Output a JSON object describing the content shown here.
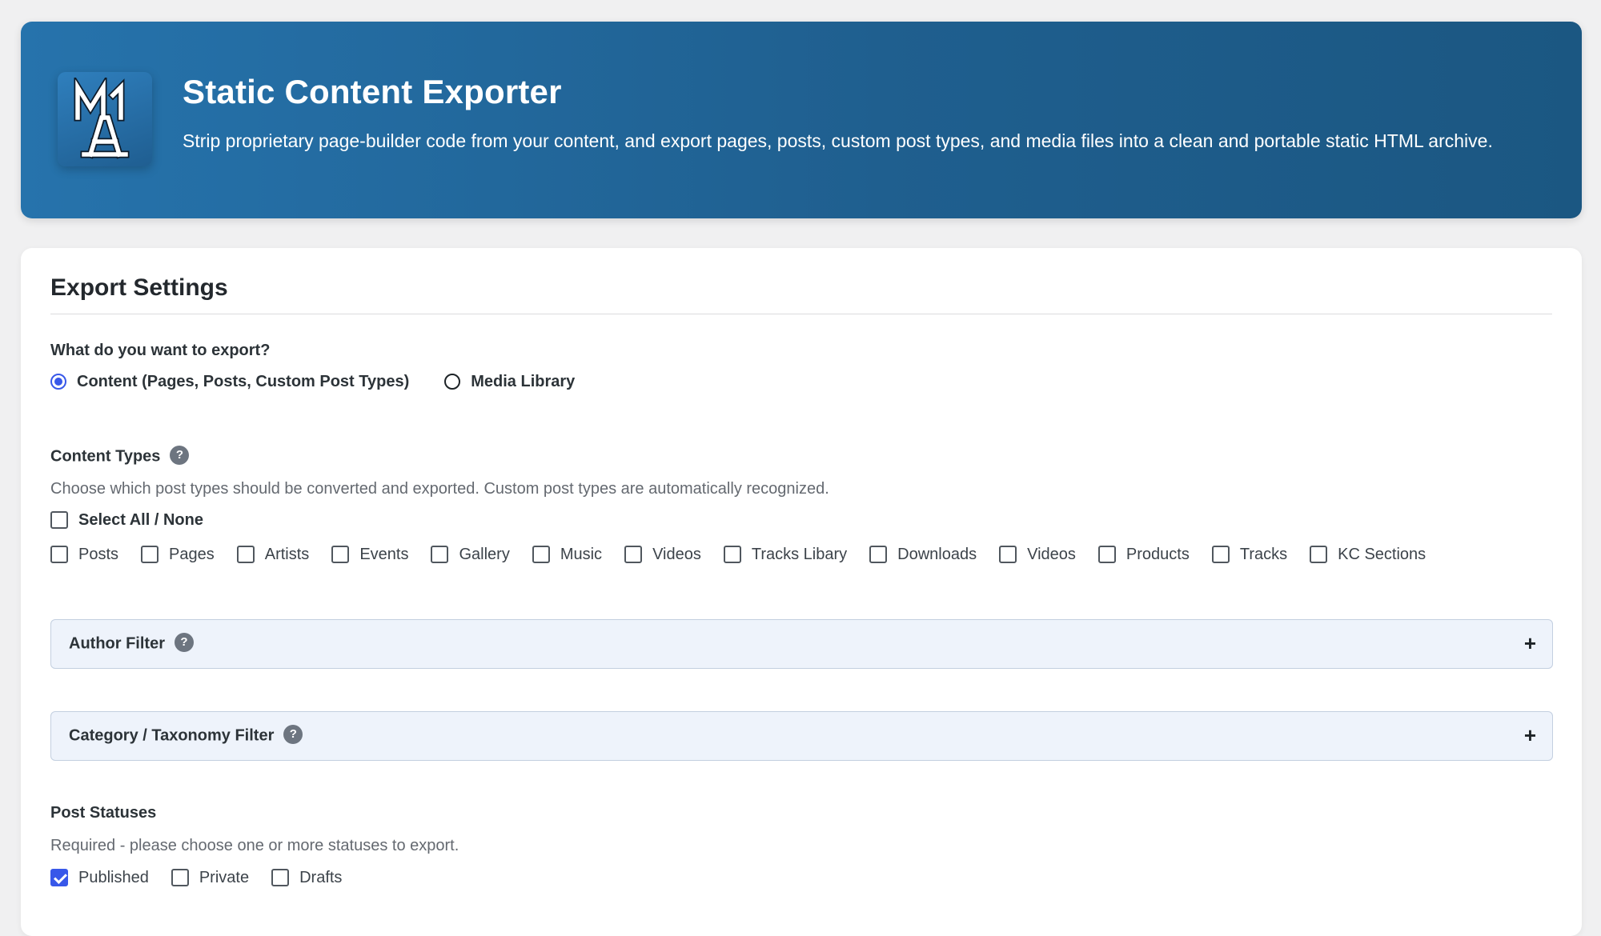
{
  "header": {
    "title": "Static Content Exporter",
    "description": "Strip proprietary page-builder code from your content, and export pages, posts, custom post types, and media files into a clean and portable static HTML archive.",
    "logo_icon": "tower-monogram-logo",
    "gradient_start": "#2673ac",
    "gradient_end": "#1b5782"
  },
  "export_settings": {
    "title": "Export Settings",
    "export_question": "What do you want to export?",
    "export_options": [
      {
        "label": "Content (Pages, Posts, Custom Post Types)",
        "checked": true
      },
      {
        "label": "Media Library",
        "checked": false
      }
    ],
    "content_types": {
      "label": "Content Types",
      "help_glyph": "?",
      "description": "Choose which post types should be converted and exported. Custom post types are automatically recognized.",
      "select_all_label": "Select All / None",
      "items": [
        "Posts",
        "Pages",
        "Artists",
        "Events",
        "Gallery",
        "Music",
        "Videos",
        "Tracks Libary",
        "Downloads",
        "Videos",
        "Products",
        "Tracks",
        "KC Sections"
      ]
    },
    "author_filter": {
      "label": "Author Filter",
      "help_glyph": "?",
      "toggle": "+"
    },
    "taxonomy_filter": {
      "label": "Category / Taxonomy Filter",
      "help_glyph": "?",
      "toggle": "+"
    },
    "post_statuses": {
      "label": "Post Statuses",
      "description": "Required - please choose one or more statuses to export.",
      "items": [
        {
          "label": "Published",
          "checked": true
        },
        {
          "label": "Private",
          "checked": false
        },
        {
          "label": "Drafts",
          "checked": false
        }
      ]
    },
    "accent_color": "#3858e9"
  }
}
